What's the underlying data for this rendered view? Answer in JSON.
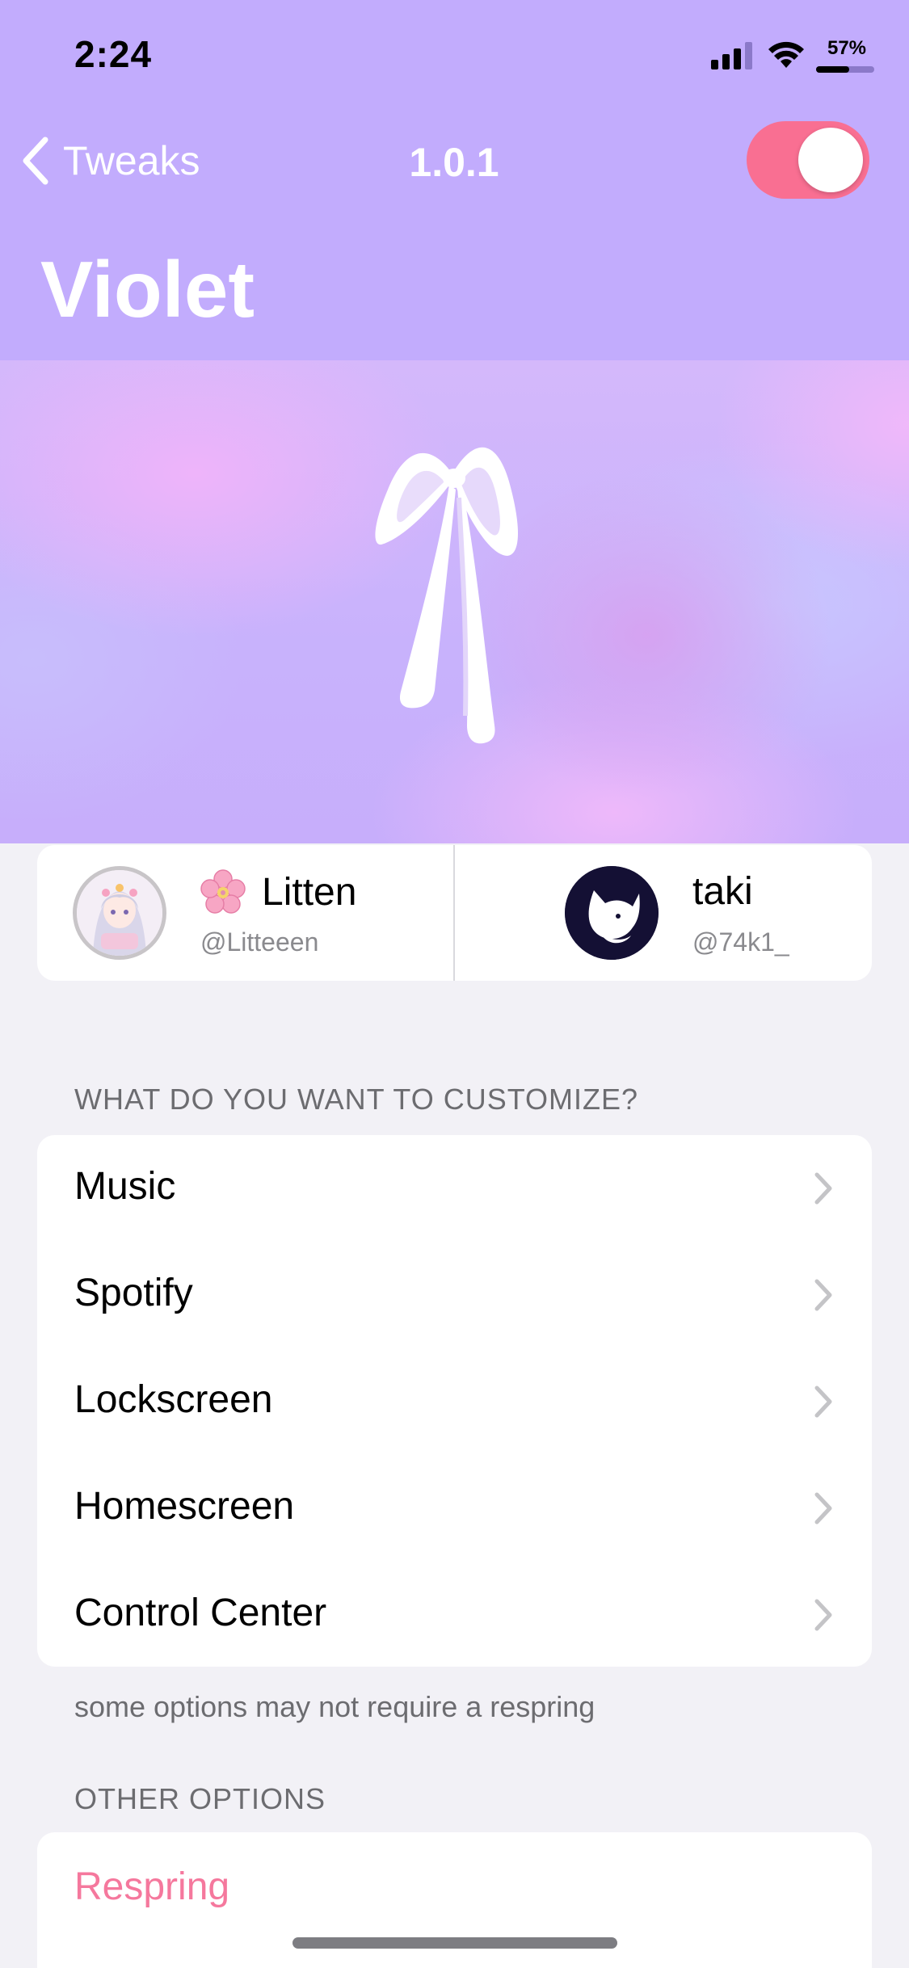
{
  "status_bar": {
    "time": "2:24",
    "battery_percent": "57%",
    "battery_level": 0.57,
    "icons": [
      "signal-icon",
      "wifi-icon",
      "battery-icon"
    ]
  },
  "nav": {
    "back_label": "Tweaks",
    "title": "1.0.1",
    "enabled": true,
    "large_title": "Violet"
  },
  "banner": {
    "icon": "ribbon-icon"
  },
  "credits": [
    {
      "name": "Litten",
      "handle": "@Litteeen",
      "emoji_icon": "cherry-blossom-icon"
    },
    {
      "name": "taki",
      "handle": "@74k1_"
    }
  ],
  "customize_section": {
    "header": "WHAT DO YOU WANT TO CUSTOMIZE?",
    "items": [
      {
        "label": "Music"
      },
      {
        "label": "Spotify"
      },
      {
        "label": "Lockscreen"
      },
      {
        "label": "Homescreen"
      },
      {
        "label": "Control Center"
      }
    ],
    "footer": "some options may not require a respring"
  },
  "other_section": {
    "header": "OTHER OPTIONS",
    "items": [
      {
        "label": "Respring"
      }
    ]
  },
  "colors": {
    "header_bg": "#c2acfd",
    "toggle_on": "#f96f92",
    "destructive": "#f5789d",
    "grouped_bg": "#f2f1f6"
  }
}
